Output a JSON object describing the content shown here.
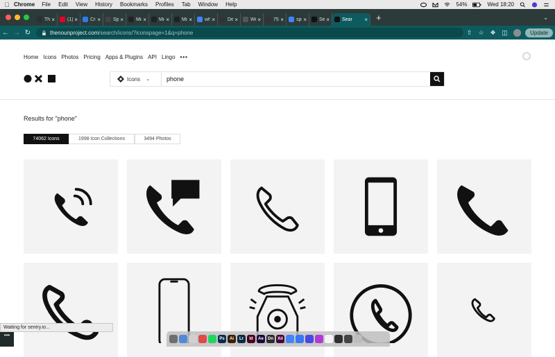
{
  "menubar": {
    "app": "Chrome",
    "items": [
      "File",
      "Edit",
      "View",
      "History",
      "Bookmarks",
      "Profiles",
      "Tab",
      "Window",
      "Help"
    ],
    "battery": "54%",
    "clock": "Wed 18:20"
  },
  "tabs": [
    {
      "title": "The",
      "color": "#2e2e2e"
    },
    {
      "title": "(1) P",
      "color": "#e60023"
    },
    {
      "title": "Crea",
      "color": "#2b7de9"
    },
    {
      "title": "Spot",
      "color": "#444444"
    },
    {
      "title": "Micr",
      "color": "#222222"
    },
    {
      "title": "Micr",
      "color": "#222222"
    },
    {
      "title": "Micr",
      "color": "#222222"
    },
    {
      "title": "whe",
      "color": "#4285f4"
    },
    {
      "title": "Des",
      "color": "#333333"
    },
    {
      "title": "Wed",
      "color": "#555555"
    },
    {
      "title": "750",
      "color": "#333333"
    },
    {
      "title": "spot",
      "color": "#4285f4"
    },
    {
      "title": "Sear",
      "color": "#111111"
    },
    {
      "title": "Sear",
      "color": "#111111",
      "active": true
    }
  ],
  "address": {
    "domain": "thenounproject.com",
    "path": "/search/icons/?iconspage=1&q=phone"
  },
  "update_label": "Update",
  "nav": {
    "items": [
      "Home",
      "Icons",
      "Photos",
      "Pricing",
      "Apps & Plugins",
      "API",
      "Lingo"
    ],
    "more": "•••"
  },
  "search": {
    "type": "Icons",
    "query": "phone"
  },
  "results_title": "Results for \"phone\"",
  "filters": [
    {
      "label": "74062 Icons",
      "active": true
    },
    {
      "label": "1998 Icon Collections",
      "active": false
    },
    {
      "label": "3494 Photos",
      "active": false
    }
  ],
  "status_text": "Waiting for sentry.io...",
  "dock_label": "•••",
  "dock_apps": [
    {
      "label": "",
      "color": "#6f6f6f"
    },
    {
      "label": "",
      "color": "#4f8ad8"
    },
    {
      "label": "",
      "color": "#d0d0d0"
    },
    {
      "label": "",
      "color": "#e04a4a"
    },
    {
      "label": "",
      "color": "#1ed760"
    },
    {
      "label": "Ps",
      "color": "#0b2c4e"
    },
    {
      "label": "Ai",
      "color": "#3b1f00"
    },
    {
      "label": "Lr",
      "color": "#0b2a45"
    },
    {
      "label": "Id",
      "color": "#49021f"
    },
    {
      "label": "Ae",
      "color": "#1a0a3a"
    },
    {
      "label": "Dn",
      "color": "#2b2b2b"
    },
    {
      "label": "Xd",
      "color": "#470137"
    },
    {
      "label": "",
      "color": "#4285f4"
    },
    {
      "label": "",
      "color": "#3478f6"
    },
    {
      "label": "",
      "color": "#4a4ae0"
    },
    {
      "label": "",
      "color": "#b03bd6"
    },
    {
      "label": "",
      "color": "#f4f4f4"
    },
    {
      "label": "",
      "color": "#2f2f2f"
    },
    {
      "label": "",
      "color": "#444444"
    },
    {
      "label": "",
      "color": "#bdbdbd"
    }
  ]
}
